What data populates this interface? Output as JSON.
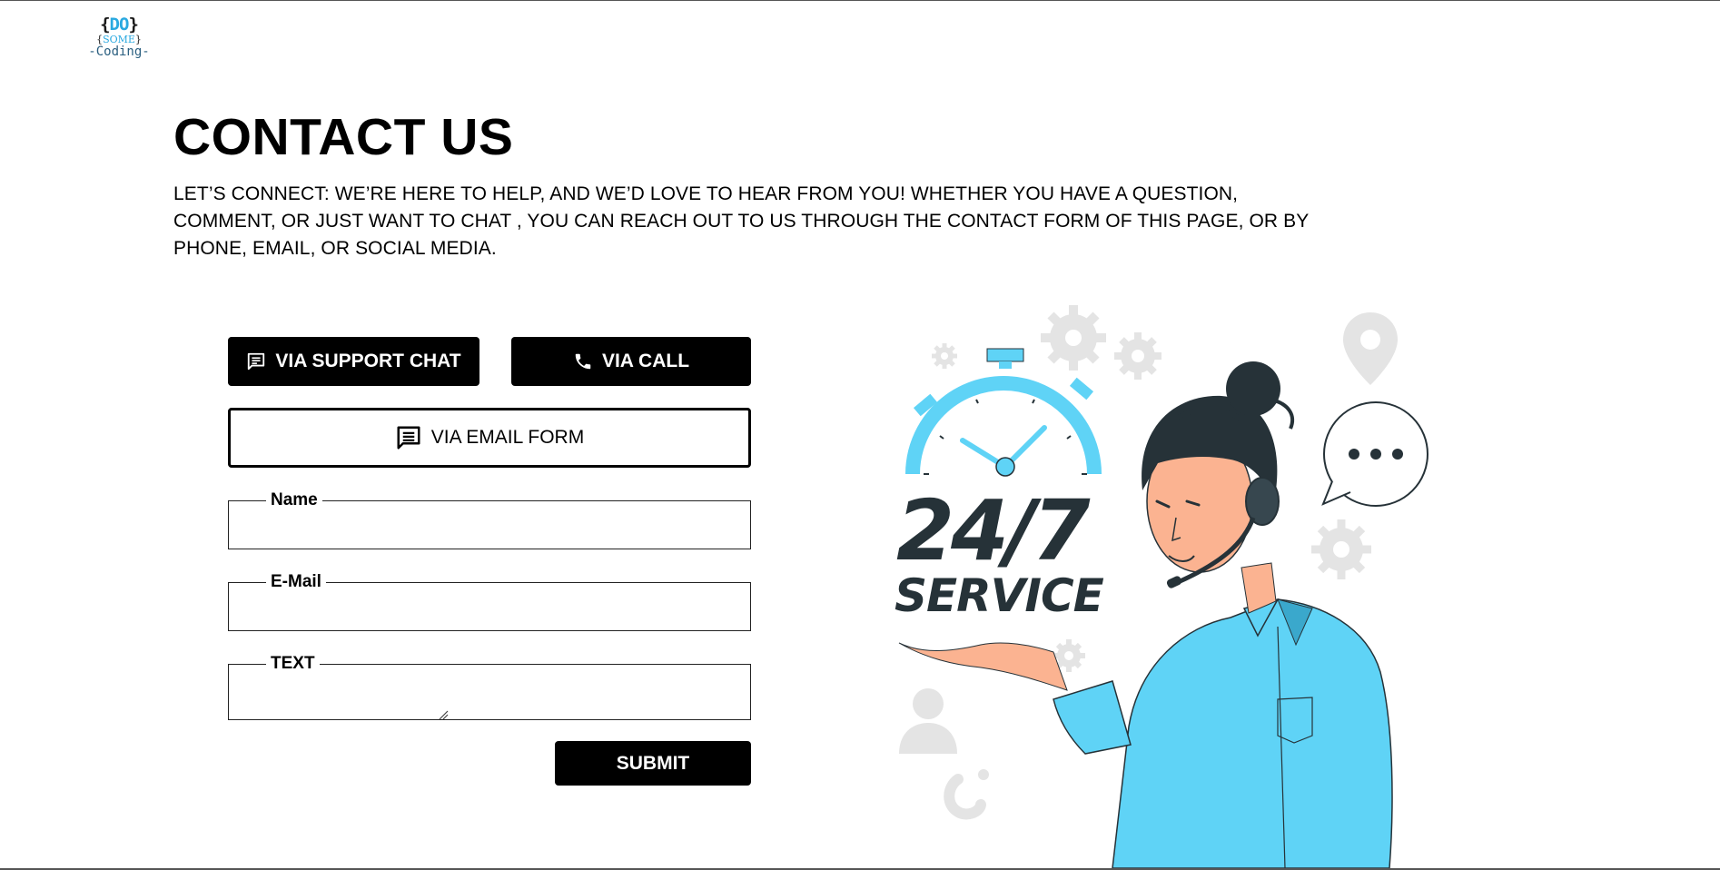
{
  "logo": {
    "line1_open": "{",
    "line1_accent": "DO",
    "line1_close": "}",
    "line2_open": "{",
    "line2_accent": "SOME",
    "line2_close": "}",
    "line3": "-Coding-"
  },
  "page": {
    "title": "CONTACT US",
    "intro": "LET’S CONNECT: WE’RE HERE TO HELP, AND WE’D LOVE TO HEAR FROM YOU! WHETHER YOU HAVE A QUESTION, COMMENT, OR JUST WANT TO CHAT , YOU CAN REACH OUT TO US THROUGH THE CONTACT FORM OF THIS PAGE, OR BY PHONE, EMAIL, OR SOCIAL MEDIA."
  },
  "contact_options": {
    "support_chat_label": "VIA SUPPORT CHAT",
    "call_label": "VIA CALL",
    "email_form_label": "VIA EMAIL FORM"
  },
  "form": {
    "name_label": "Name",
    "name_value": "",
    "email_label": "E-Mail",
    "email_value": "",
    "text_label": "TEXT",
    "text_value": "",
    "submit_label": "SUBMIT"
  },
  "illustration": {
    "headline": "24/7",
    "subline": "SERVICE",
    "accent_color": "#5fd3f6",
    "skin_color": "#fbb391",
    "hair_color": "#263238",
    "icon_gray": "#e6e6e6"
  },
  "icons": {
    "chat": "chat-bubble-icon",
    "call": "phone-icon",
    "email": "message-icon"
  }
}
